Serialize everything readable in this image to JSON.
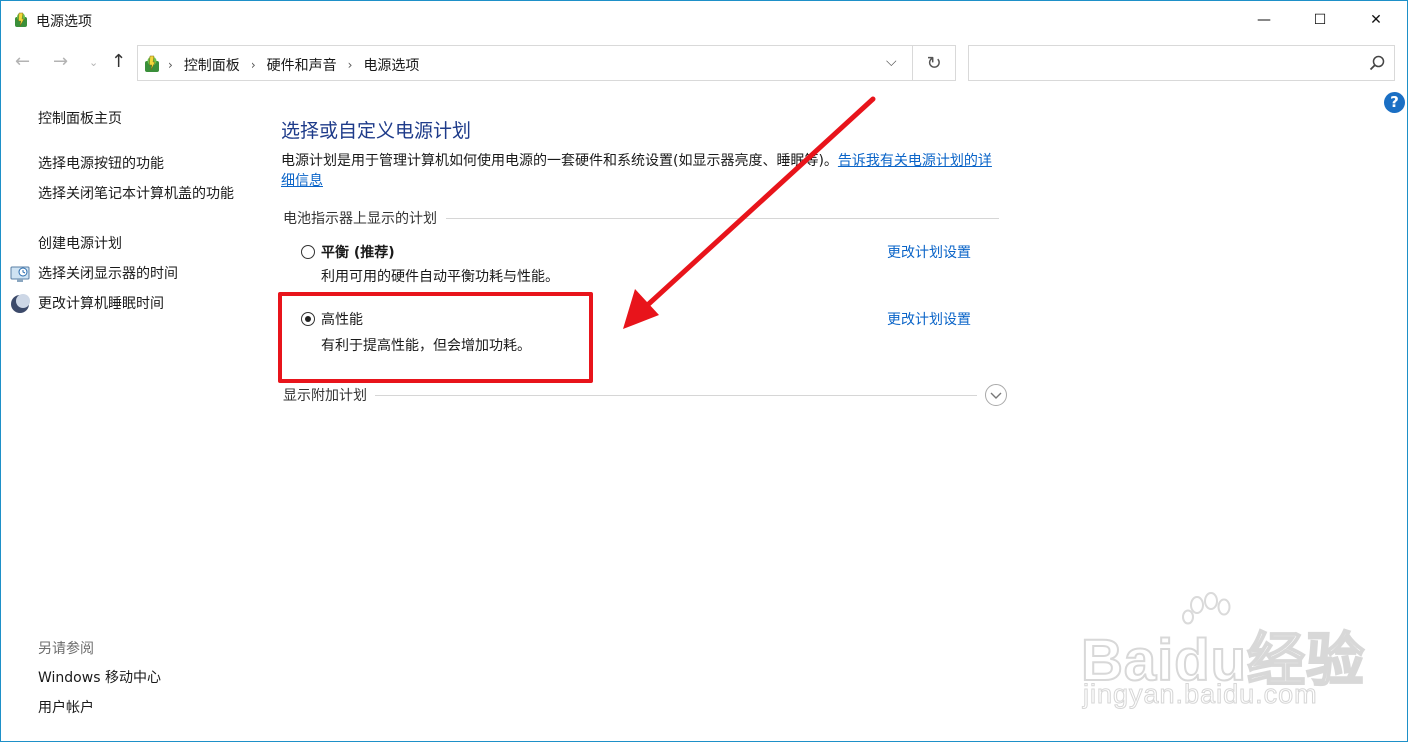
{
  "window": {
    "title": "电源选项",
    "icon": "power-options-icon",
    "controls": {
      "minimize": "—",
      "maximize": "☐",
      "close": "✕"
    }
  },
  "nav": {
    "breadcrumb": [
      "控制面板",
      "硬件和声音",
      "电源选项"
    ],
    "search_placeholder": ""
  },
  "sidebar": {
    "home": "控制面板主页",
    "links": [
      "选择电源按钮的功能",
      "选择关闭笔记本计算机盖的功能",
      "创建电源计划",
      "选择关闭显示器的时间",
      "更改计算机睡眠时间"
    ],
    "see_also_label": "另请参阅",
    "see_also": [
      "Windows 移动中心",
      "用户帐户"
    ]
  },
  "main": {
    "title": "选择或自定义电源计划",
    "description": "电源计划是用于管理计算机如何使用电源的一套硬件和系统设置(如显示器亮度、睡眠等)。",
    "description_link": "告诉我有关电源计划的详细信息",
    "group_label": "电池指示器上显示的计划",
    "plans": [
      {
        "name": "平衡 (推荐)",
        "desc": "利用可用的硬件自动平衡功耗与性能。",
        "link": "更改计划设置",
        "selected": false
      },
      {
        "name": "高性能",
        "desc": "有利于提高性能，但会增加功耗。",
        "link": "更改计划设置",
        "selected": true
      }
    ],
    "more_plans_label": "显示附加计划"
  },
  "annotation": {
    "color": "#e8141b"
  },
  "watermark": {
    "text": "Baidu经验",
    "sub": "jingyan.baidu.com"
  },
  "colors": {
    "title_blue": "#1e3b8a",
    "link_blue": "#0a64c8",
    "border": "#1e90c8"
  }
}
